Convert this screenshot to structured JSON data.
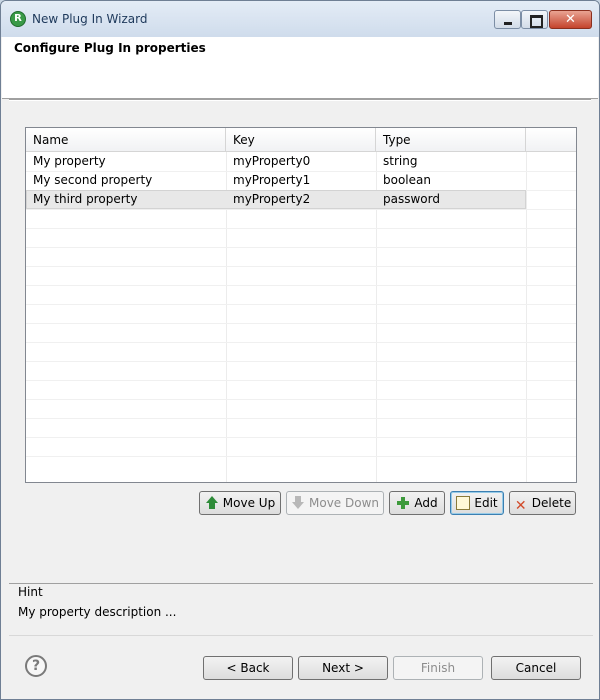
{
  "window": {
    "title": "New Plug In Wizard",
    "app_icon_letter": "R"
  },
  "header": {
    "title": "Configure Plug In properties"
  },
  "table": {
    "columns": [
      "Name",
      "Key",
      "Type"
    ],
    "rows": [
      {
        "name": "My property",
        "key": "myProperty0",
        "type": "string"
      },
      {
        "name": "My second property",
        "key": "myProperty1",
        "type": "boolean"
      },
      {
        "name": "My third property",
        "key": "myProperty2",
        "type": "password"
      }
    ],
    "selected_row": 2
  },
  "table_buttons": {
    "move_up": "Move Up",
    "move_down": "Move Down",
    "add": "Add",
    "edit": "Edit",
    "delete": "Delete"
  },
  "hint": {
    "label": "Hint",
    "text": "My property description ..."
  },
  "footer": {
    "back": "< Back",
    "next": "Next >",
    "finish": "Finish",
    "cancel": "Cancel",
    "help_glyph": "?"
  }
}
